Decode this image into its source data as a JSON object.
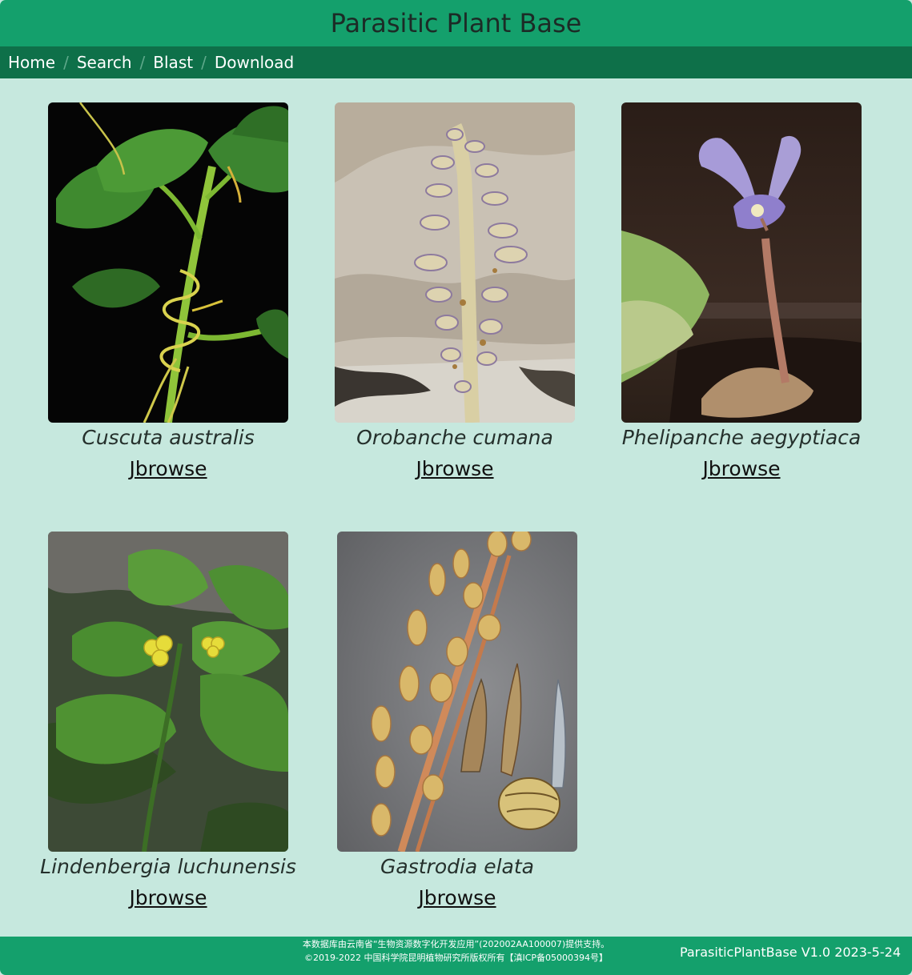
{
  "header": {
    "title": "Parasitic Plant Base"
  },
  "nav": {
    "items": [
      {
        "label": "Home"
      },
      {
        "label": "Search"
      },
      {
        "label": "Blast"
      },
      {
        "label": "Download"
      }
    ],
    "separator": "/"
  },
  "plants": [
    {
      "name": "Cuscuta australis",
      "link": "Jbrowse",
      "photo_icon": "dodder-vine-photo"
    },
    {
      "name": "Orobanche cumana",
      "link": "Jbrowse",
      "photo_icon": "broomrape-spike-photo"
    },
    {
      "name": "Phelipanche aegyptiaca",
      "link": "Jbrowse",
      "photo_icon": "purple-flower-photo"
    },
    {
      "name": "Lindenbergia luchunensis",
      "link": "Jbrowse",
      "photo_icon": "leafy-plant-photo"
    },
    {
      "name": "Gastrodia elata",
      "link": "Jbrowse",
      "photo_icon": "orchid-tuber-photo"
    }
  ],
  "footer": {
    "line1": "本数据库由云南省“生物资源数字化开发应用”(202002AA100007)提供支持。",
    "line2": "©2019-2022 中国科学院昆明植物研究所版权所有【滇ICP备05000394号】",
    "version": "ParasiticPlantBase V1.0 2023-5-24"
  },
  "colors": {
    "header": "#14a06c",
    "nav": "#0e7049",
    "background": "#c6e8de",
    "footer": "#14a06c"
  }
}
